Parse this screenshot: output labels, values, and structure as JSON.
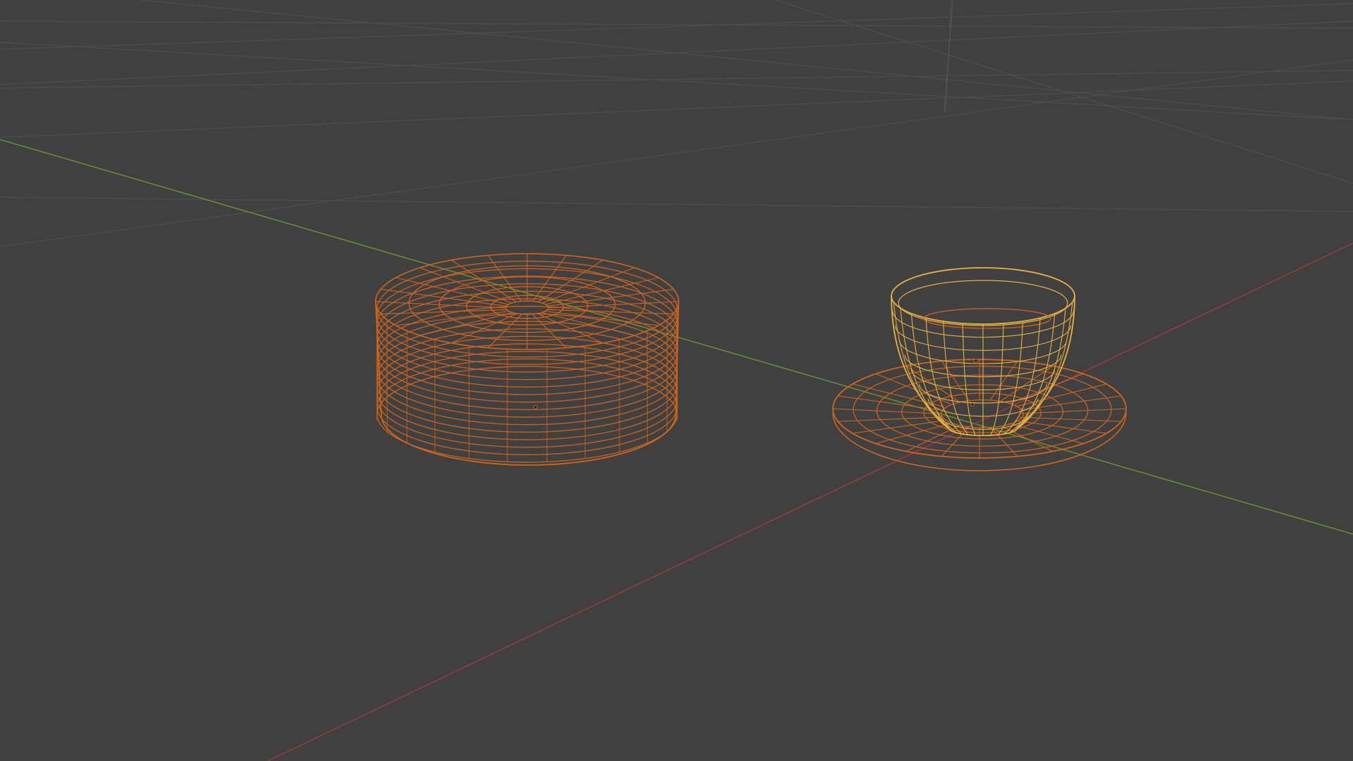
{
  "viewport": {
    "background": "#404040",
    "grid_color": "#4e4e4e",
    "x_axis_color": "#9b3a44",
    "y_axis_color": "#6a8f2e",
    "z_axis_color": "#555555",
    "selected_color": "#d3641c",
    "active_color": "#e8b040",
    "shading": "wireframe"
  },
  "scene": {
    "objects": [
      {
        "name": "plate-stack",
        "type": "mesh",
        "state": "selected",
        "count": 16
      },
      {
        "name": "saucer",
        "type": "mesh",
        "state": "selected"
      },
      {
        "name": "cup",
        "type": "mesh",
        "state": "active"
      }
    ]
  }
}
